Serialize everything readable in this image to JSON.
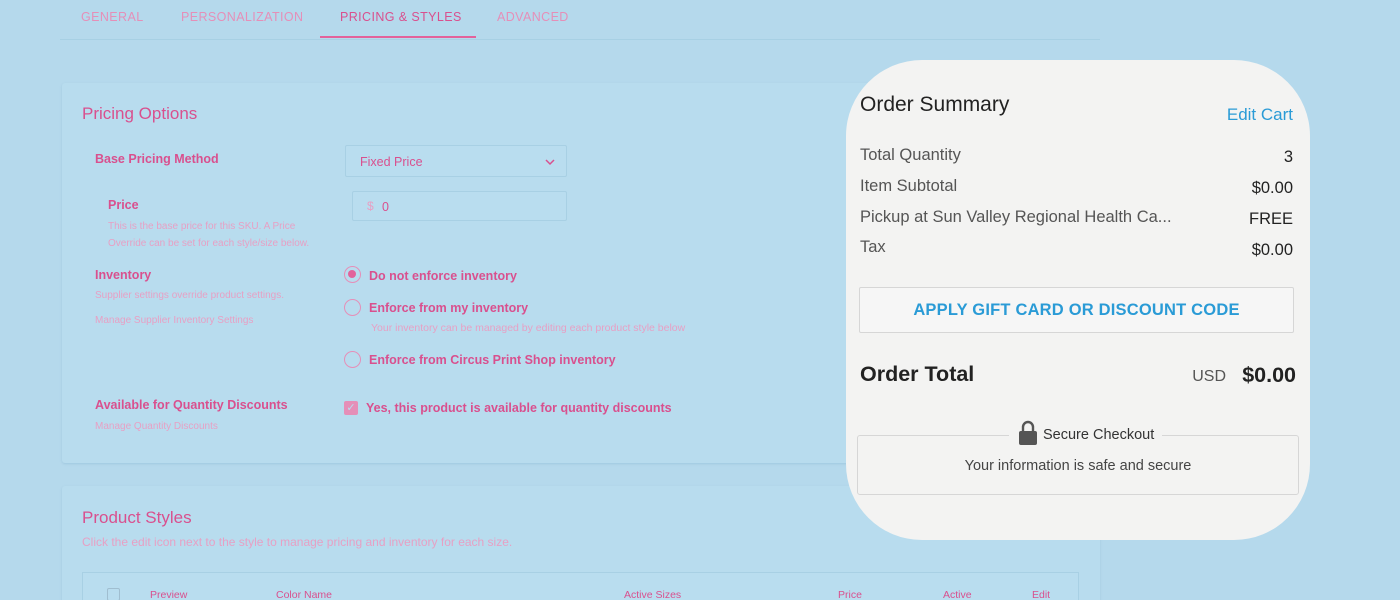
{
  "tabs": [
    {
      "label": "GENERAL"
    },
    {
      "label": "PERSONALIZATION"
    },
    {
      "label": "PRICING & STYLES"
    },
    {
      "label": "ADVANCED"
    }
  ],
  "pricing": {
    "title": "Pricing Options",
    "base_method_label": "Base Pricing Method",
    "base_method_value": "Fixed Price",
    "price_label": "Price",
    "price_help_1": "This is the base price for this SKU. A Price",
    "price_help_2": "Override can be set for each style/size below.",
    "currency_symbol": "$",
    "price_value": "0",
    "inventory_label": "Inventory",
    "inventory_help": "Supplier settings override product settings.",
    "inventory_link": "Manage Supplier Inventory Settings",
    "inventory_options": [
      {
        "label": "Do not enforce inventory",
        "selected": true
      },
      {
        "label": "Enforce from my inventory",
        "selected": false,
        "help": "Your inventory can be managed by editing each product style below"
      },
      {
        "label": "Enforce from Circus Print Shop inventory",
        "selected": false
      }
    ],
    "qty_discount_label": "Available for Quantity Discounts",
    "qty_discount_link": "Manage Quantity Discounts",
    "qty_discount_option": "Yes, this product is available for quantity discounts"
  },
  "styles": {
    "title": "Product Styles",
    "subtitle": "Click the edit icon next to the style to manage pricing and inventory for each size.",
    "columns": [
      "Preview",
      "Color Name",
      "Active Sizes",
      "Price",
      "Active",
      "Edit"
    ]
  },
  "summary": {
    "title": "Order Summary",
    "edit_cart": "Edit Cart",
    "rows": [
      {
        "label": "Total Quantity",
        "value": "3"
      },
      {
        "label": "Item Subtotal",
        "value": "$0.00"
      },
      {
        "label": "Pickup at Sun Valley Regional Health Ca...",
        "value": "FREE"
      },
      {
        "label": "Tax",
        "value": "$0.00"
      }
    ],
    "apply_button": "APPLY GIFT CARD OR DISCOUNT CODE",
    "total_label": "Order Total",
    "total_currency": "USD",
    "total_value": "$0.00",
    "secure_title": "Secure Checkout",
    "secure_message": "Your information is safe and secure"
  },
  "colors": {
    "accent_pink": "#e2629b",
    "link_blue": "#2a9bd6",
    "background": "#b5d9ec"
  },
  "icons": {
    "select_chevron": "chevron-down-icon",
    "secure": "lock-icon"
  }
}
